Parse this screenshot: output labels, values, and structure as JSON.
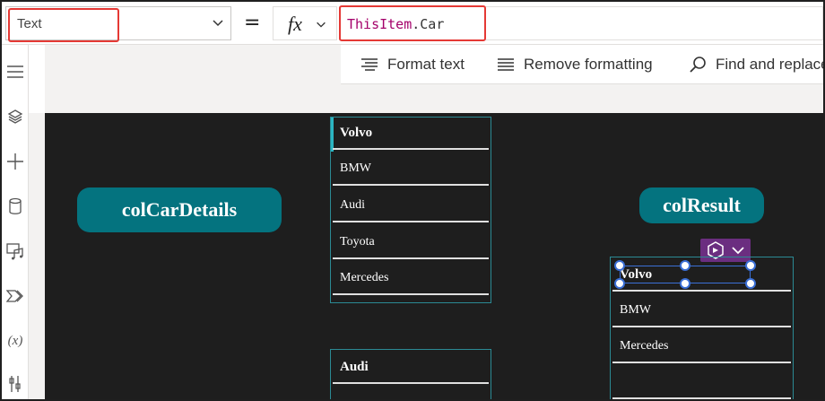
{
  "formula_bar": {
    "property_value": "Text",
    "equals": "=",
    "fx_label": "fx",
    "formula_keyword": "ThisItem",
    "formula_rest": ".Car"
  },
  "toolbar": {
    "format_text": "Format text",
    "remove_formatting": "Remove formatting",
    "find_replace": "Find and replace"
  },
  "left_rail": {
    "icons": [
      "hamburger-menu-icon",
      "layers-icon",
      "plus-icon",
      "database-icon",
      "media-icon",
      "theme-icon",
      "variables-icon",
      "tools-icon"
    ],
    "variables_label": "(x)"
  },
  "canvas": {
    "col_car_details_label": "colCarDetails",
    "col_result_label": "colResult",
    "gallery_top": [
      "Volvo",
      "BMW",
      "Audi",
      "Toyota",
      "Mercedes"
    ],
    "gallery_bottom": [
      "Audi"
    ],
    "gallery_result": [
      "Volvo",
      "BMW",
      "Mercedes"
    ]
  },
  "colors": {
    "highlight": "#e53935",
    "pill": "#04737f",
    "canvas_bg": "#1e1e1e",
    "context_button": "#6b2e80",
    "formula_keyword": "#a4006a"
  }
}
